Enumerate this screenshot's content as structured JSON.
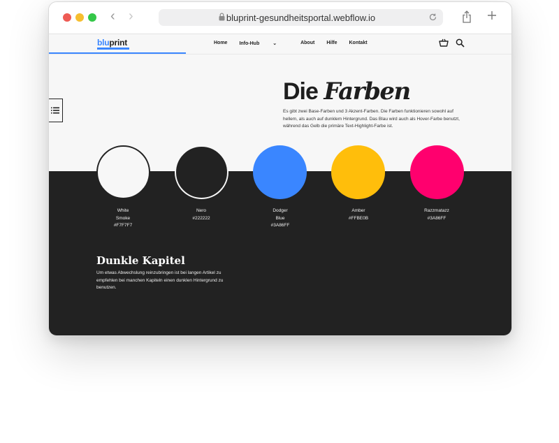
{
  "browser": {
    "url": "bluprint-gesundheitsportal.webflow.io"
  },
  "site": {
    "logo": {
      "part1": "blu",
      "part2": "print"
    },
    "nav": [
      {
        "label": "Home"
      },
      {
        "label": "Info-Hub",
        "has_dropdown": true
      },
      {
        "label": "About"
      },
      {
        "label": "Hilfe"
      },
      {
        "label": "Kontakt"
      }
    ],
    "icons": {
      "cart": "basket-icon",
      "search": "search-icon",
      "toc": "list-icon"
    }
  },
  "main": {
    "headline_regular": "Die",
    "headline_italic": "Farben",
    "intro": "Es gibt zwei Base-Farben und 3 Akzent-Farben. Die Farben funktionieren sowohl auf hellem, als auch auf dunklem Hintergrund. Das Blau wird auch als Hover-Farbe benutzt, während das Gelb die primäre Text-Highlight-Farbe ist.",
    "swatches": [
      {
        "name_line1": "White",
        "name_line2": "Smoke",
        "hex": "#F7F7F7",
        "color": "#F7F7F7"
      },
      {
        "name_line1": "Nero",
        "name_line2": "",
        "hex": "#222222",
        "color": "#222222"
      },
      {
        "name_line1": "Dodger",
        "name_line2": "Blue",
        "hex": "#3A86FF",
        "color": "#3A86FF"
      },
      {
        "name_line1": "Amber",
        "name_line2": "",
        "hex": "#FFBE0B",
        "color": "#FFBE0B"
      },
      {
        "name_line1": "Razzmatazz",
        "name_line2": "",
        "hex": "#3A86FF",
        "color": "#FF006E"
      }
    ],
    "dark_title": "Dunkle Kapitel",
    "dark_text": "Um etwas Abwechslung reinzubringen ist bei langen Artikel zu empfehlen bei manchen Kapiteln einen dunklen Hintergrund zu benutzen."
  }
}
